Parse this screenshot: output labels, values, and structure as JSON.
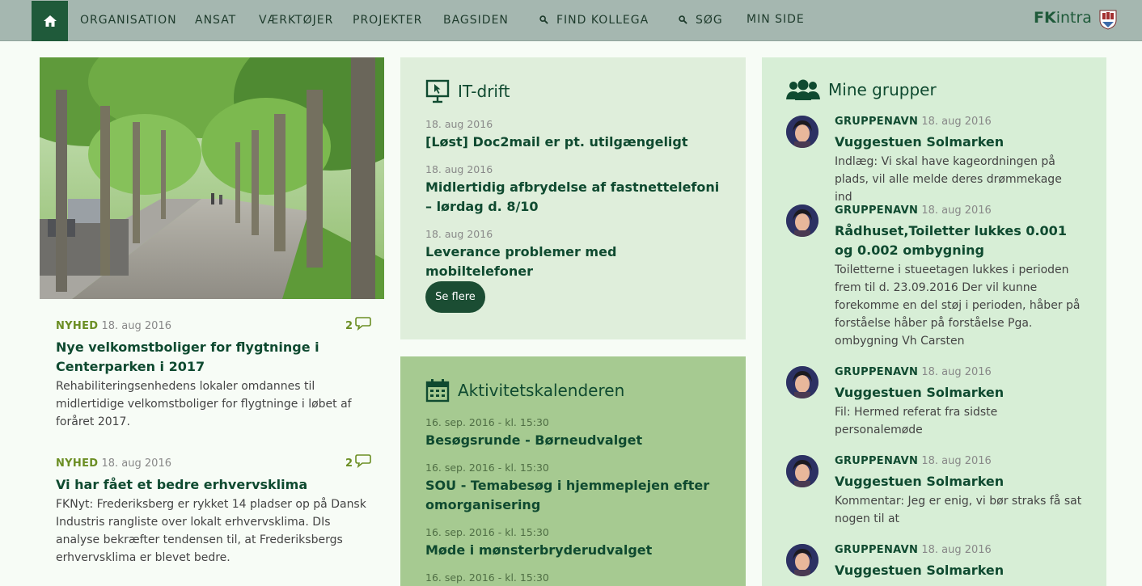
{
  "nav": {
    "home_icon": "home-icon",
    "items": [
      "ORGANISATION",
      "ANSAT",
      "VÆRKTØJER",
      "PROJEKTER",
      "BAGSIDEN"
    ],
    "find_colleague": "FIND KOLLEGA",
    "search": "SØG",
    "my_page": "MIN SIDE",
    "brand_bold": "FK",
    "brand_rest": "intra"
  },
  "news": [
    {
      "tag": "NYHED",
      "date": "18. aug 2016",
      "comments": "2",
      "title": "Nye velkomstboliger for flygtninge i Centerparken i 2017",
      "text": "Rehabiliteringsenhedens lokaler omdannes til midlertidige velkomstboliger for flygtninge i løbet af foråret 2017."
    },
    {
      "tag": "NYHED",
      "date": "18. aug 2016",
      "comments": "2",
      "title": "Vi har fået et bedre erhvervsklima",
      "text": "FKNyt: Frederiksberg er rykket 14 pladser op på Dansk Industris rangliste over lokalt erhvervsklima. DIs analyse bekræfter tendensen til, at Frederiksbergs erhvervsklima er blevet bedre."
    }
  ],
  "it": {
    "title": "IT-drift",
    "items": [
      {
        "date": "18. aug 2016",
        "title": "[Løst] Doc2mail er pt. utilgængeligt"
      },
      {
        "date": "18. aug 2016",
        "title": "Midlertidig afbrydelse af fastnettelefoni – lørdag d. 8/10"
      },
      {
        "date": "18. aug 2016",
        "title": "Leverance problemer med mobiltelefoner"
      }
    ],
    "more": "Se flere"
  },
  "calendar": {
    "title": "Aktivitetskalenderen",
    "items": [
      {
        "date": "16. sep. 2016  - kl. 15:30",
        "title": "Besøgsrunde - Børneudvalget"
      },
      {
        "date": "16. sep. 2016  - kl. 15:30",
        "title": "SOU - Temabesøg i hjemmeplejen efter omorganisering"
      },
      {
        "date": "16. sep. 2016  - kl. 15:30",
        "title": "Møde i mønsterbryderudvalget"
      },
      {
        "date": "16. sep. 2016  - kl. 15:30",
        "title": ""
      }
    ]
  },
  "groups": {
    "title": "Mine grupper",
    "items": [
      {
        "label": "GRUPPENAVN",
        "date": "18. aug 2016",
        "title": "Vuggestuen Solmarken",
        "text": "Indlæg: Vi skal have kageordningen på plads, vil alle melde deres drømmekage ind"
      },
      {
        "label": "GRUPPENAVN",
        "date": "18. aug 2016",
        "title": "Rådhuset,Toiletter lukkes 0.001 og 0.002 ombygning",
        "text": "Toiletterne i stueetagen lukkes i perioden frem til d. 23.09.2016 Der vil kunne forekomme en del støj i perioden, håber på forståelse håber på forståelse Pga. ombygning Vh Carsten"
      },
      {
        "label": "GRUPPENAVN",
        "date": "18. aug 2016",
        "title": "Vuggestuen Solmarken",
        "text": "Fil: Hermed referat fra sidste personalemøde"
      },
      {
        "label": "GRUPPENAVN",
        "date": "18. aug 2016",
        "title": "Vuggestuen Solmarken",
        "text": "Kommentar: Jeg er enig, vi bør straks få sat nogen til at"
      },
      {
        "label": "GRUPPENAVN",
        "date": "18. aug 2016",
        "title": "Vuggestuen Solmarken",
        "text": ""
      }
    ]
  },
  "colors": {
    "nav_bg": "#a5b7b0",
    "home_bg": "#1f5a3a",
    "heading": "#0f4a30",
    "tag_green": "#6b8e23",
    "it_bg": "#dfeedb",
    "calendar_bg": "#a6ca91",
    "groups_bg": "#d7eed6",
    "button_bg": "#1b4d33"
  }
}
